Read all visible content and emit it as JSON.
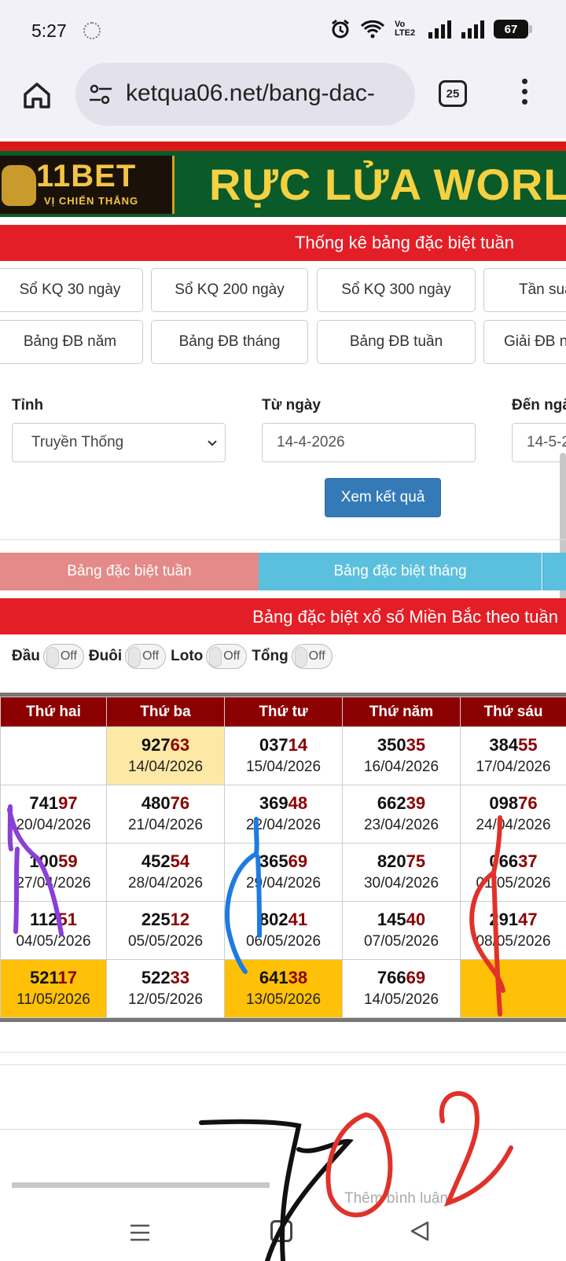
{
  "statusbar": {
    "time": "5:27",
    "battery": "67",
    "network_label": "Vo LTE2"
  },
  "browser": {
    "url": "ketqua06.net/bang-dac-",
    "tab_count": "25"
  },
  "ad_banner": {
    "brand": "11BET",
    "brand_sub": "VỊ CHIẾN THẮNG",
    "slogan": "RỰC LỬA WORL"
  },
  "page": {
    "section_title": "Thống kê bảng đặc biệt tuần",
    "quick_links_row1": [
      "Sổ KQ 30 ngày",
      "Sổ KQ 200 ngày",
      "Sổ KQ 300 ngày",
      "Tần suấ"
    ],
    "quick_links_row2": [
      "Bảng ĐB năm",
      "Bảng ĐB tháng",
      "Bảng ĐB tuần",
      "Giải ĐB n"
    ],
    "form": {
      "province_label": "Tỉnh",
      "province_value": "Truyền Thống",
      "from_label": "Từ ngày",
      "from_value": "14-4-2026",
      "to_label": "Đến ngà",
      "to_value": "14-5-2",
      "submit_label": "Xem kết quả"
    },
    "tabs": [
      "Bảng đặc biệt tuần",
      "Bảng đặc biệt tháng"
    ],
    "table_title": "Bảng đặc biệt xổ số Miền Bắc theo tuần",
    "toggles": [
      {
        "label": "Đầu",
        "state": "Off"
      },
      {
        "label": "Đuôi",
        "state": "Off"
      },
      {
        "label": "Loto",
        "state": "Off"
      },
      {
        "label": "Tổng",
        "state": "Off"
      }
    ],
    "table": {
      "headers": [
        "Thứ hai",
        "Thứ ba",
        "Thứ tư",
        "Thứ năm",
        "Thứ sáu"
      ],
      "rows": [
        [
          {
            "head": "",
            "tail": "",
            "date": ""
          },
          {
            "head": "927",
            "tail": "63",
            "date": "14/04/2026"
          },
          {
            "head": "037",
            "tail": "14",
            "date": "15/04/2026"
          },
          {
            "head": "350",
            "tail": "35",
            "date": "16/04/2026"
          },
          {
            "head": "384",
            "tail": "55",
            "date": "17/04/2026"
          }
        ],
        [
          {
            "head": "741",
            "tail": "97",
            "date": "20/04/2026"
          },
          {
            "head": "480",
            "tail": "76",
            "date": "21/04/2026"
          },
          {
            "head": "369",
            "tail": "48",
            "date": "22/04/2026"
          },
          {
            "head": "662",
            "tail": "39",
            "date": "23/04/2026"
          },
          {
            "head": "098",
            "tail": "76",
            "date": "24/04/2026"
          }
        ],
        [
          {
            "head": "100",
            "tail": "59",
            "date": "27/04/2026"
          },
          {
            "head": "452",
            "tail": "54",
            "date": "28/04/2026"
          },
          {
            "head": "365",
            "tail": "69",
            "date": "29/04/2026"
          },
          {
            "head": "820",
            "tail": "75",
            "date": "30/04/2026"
          },
          {
            "head": "066",
            "tail": "37",
            "date": "01/05/2026"
          }
        ],
        [
          {
            "head": "112",
            "tail": "51",
            "date": "04/05/2026"
          },
          {
            "head": "225",
            "tail": "12",
            "date": "05/05/2026"
          },
          {
            "head": "802",
            "tail": "41",
            "date": "06/05/2026"
          },
          {
            "head": "145",
            "tail": "40",
            "date": "07/05/2026"
          },
          {
            "head": "291",
            "tail": "47",
            "date": "08/05/2026"
          }
        ],
        [
          {
            "head": "521",
            "tail": "17",
            "date": "11/05/2026"
          },
          {
            "head": "522",
            "tail": "33",
            "date": "12/05/2026"
          },
          {
            "head": "641",
            "tail": "38",
            "date": "13/05/2026"
          },
          {
            "head": "766",
            "tail": "69",
            "date": "14/05/2026"
          },
          {
            "head": "",
            "tail": "",
            "date": ""
          }
        ]
      ]
    },
    "comment_placeholder": "Thêm bình luận"
  },
  "colors": {
    "red": "#e41e26",
    "dark_red": "#8b0000",
    "blue_btn": "#337ab7",
    "highlight": "#fde8a6",
    "gold": "#ffc107"
  }
}
